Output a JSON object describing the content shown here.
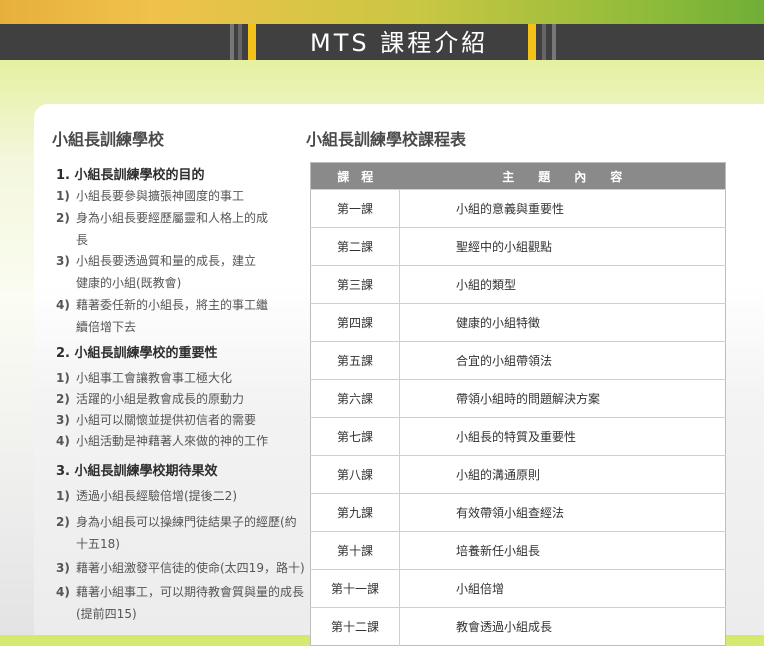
{
  "header": {
    "title": "MTS 課程介紹"
  },
  "left": {
    "title": "小組長訓練學校",
    "sections": [
      {
        "heading": "1. 小組長訓練學校的目的",
        "items": [
          {
            "num": "1)",
            "text": "小組長要參與擴張神國度的事工"
          },
          {
            "num": "2)",
            "text": "身為小組長要經歷屬靈和人格上的成",
            "cont": "長"
          },
          {
            "num": "3)",
            "text": "小組長要透過質和量的成長，建立",
            "cont": "健康的小組(既教會)"
          },
          {
            "num": "4)",
            "text": "藉著委任新的小組長，將主的事工繼",
            "cont": "續倍增下去"
          }
        ]
      },
      {
        "heading": "2. 小組長訓練學校的重要性",
        "items": [
          {
            "num": "1)",
            "text": "小組事工會讓教會事工極大化"
          },
          {
            "num": "2)",
            "text": "活躍的小組是教會成長的原動力"
          },
          {
            "num": "3)",
            "text": "小組可以關懷並提供初信者的需要"
          },
          {
            "num": "4)",
            "text": "小組活動是神藉著人來做的神的工作"
          }
        ]
      },
      {
        "heading": "3. 小組長訓練學校期待果效",
        "items": [
          {
            "num": "1)",
            "text": "透過小組長經驗倍增(提後二2)"
          },
          {
            "num": "2)",
            "text": "身為小組長可以操練門徒結果子的經歷(約",
            "cont": "十五18)"
          },
          {
            "num": "3)",
            "text": "藉著小組激發平信徒的使命(太四19，路十)"
          },
          {
            "num": "4)",
            "text": "藉著小組事工，可以期待教會質與量的成長",
            "cont": "(提前四15)"
          }
        ]
      }
    ]
  },
  "right": {
    "title": "小組長訓練學校課程表",
    "table": {
      "headers": [
        "課　程",
        "主　　題　　內　　容"
      ],
      "rows": [
        [
          "第一課",
          "小組的意義與重要性"
        ],
        [
          "第二課",
          "聖經中的小組觀點"
        ],
        [
          "第三課",
          "小組的類型"
        ],
        [
          "第四課",
          "健康的小組特徵"
        ],
        [
          "第五課",
          "合宜的小組帶領法"
        ],
        [
          "第六課",
          "帶領小組時的問題解決方案"
        ],
        [
          "第七課",
          "小組長的特質及重要性"
        ],
        [
          "第八課",
          "小組的溝通原則"
        ],
        [
          "第九課",
          "有效帶領小組查經法"
        ],
        [
          "第十課",
          "培養新任小組長"
        ],
        [
          "第十一課",
          "小組倍增"
        ],
        [
          "第十二課",
          "教會透過小組成長"
        ]
      ]
    }
  }
}
